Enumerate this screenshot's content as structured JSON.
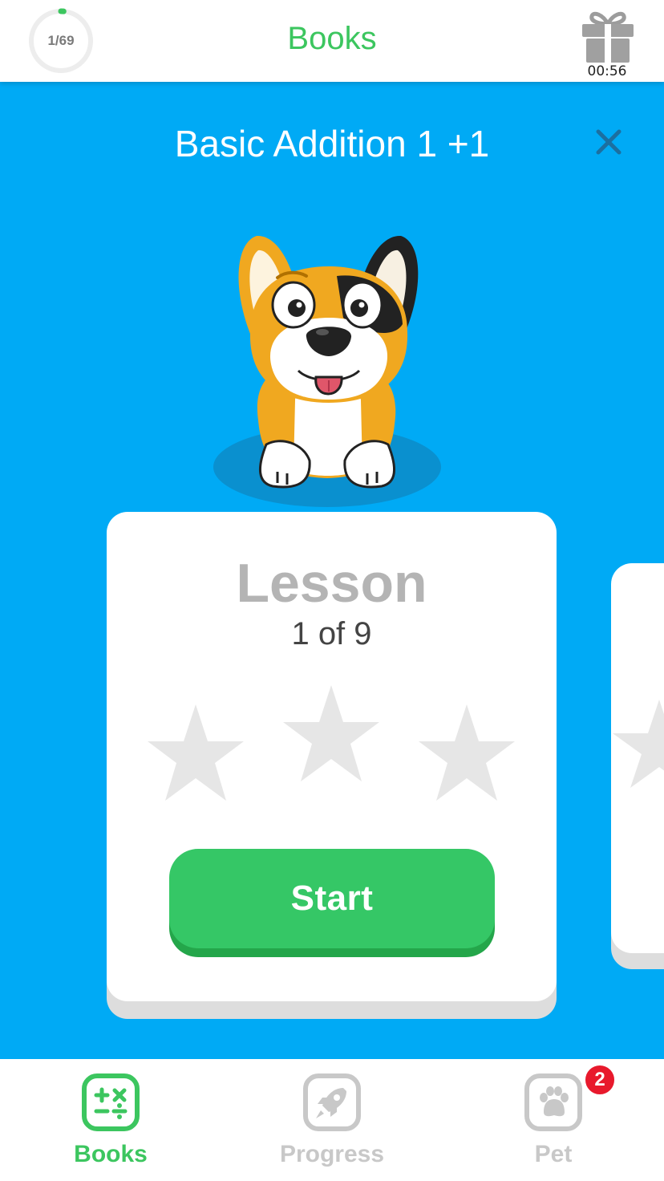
{
  "header": {
    "progress_text": "1/69",
    "progress_fraction": 0.0145,
    "title": "Books",
    "gift_timer": "00:56"
  },
  "lesson": {
    "title": "Basic Addition 1 +1",
    "card_heading": "Lesson",
    "card_subheading": "1 of 9",
    "stars_earned": 0,
    "stars_total": 3,
    "start_label": "Start"
  },
  "bottom_nav": {
    "items": [
      {
        "label": "Books",
        "icon": "math-operators-icon",
        "active": true
      },
      {
        "label": "Progress",
        "icon": "rocket-icon",
        "active": false
      },
      {
        "label": "Pet",
        "icon": "paw-icon",
        "active": false,
        "badge": "2"
      }
    ]
  },
  "colors": {
    "brand_green": "#3cc65f",
    "background_blue": "#00aaf5",
    "start_button": "#35c766",
    "inactive_gray": "#c8c8c8",
    "badge_red": "#e8192c"
  }
}
